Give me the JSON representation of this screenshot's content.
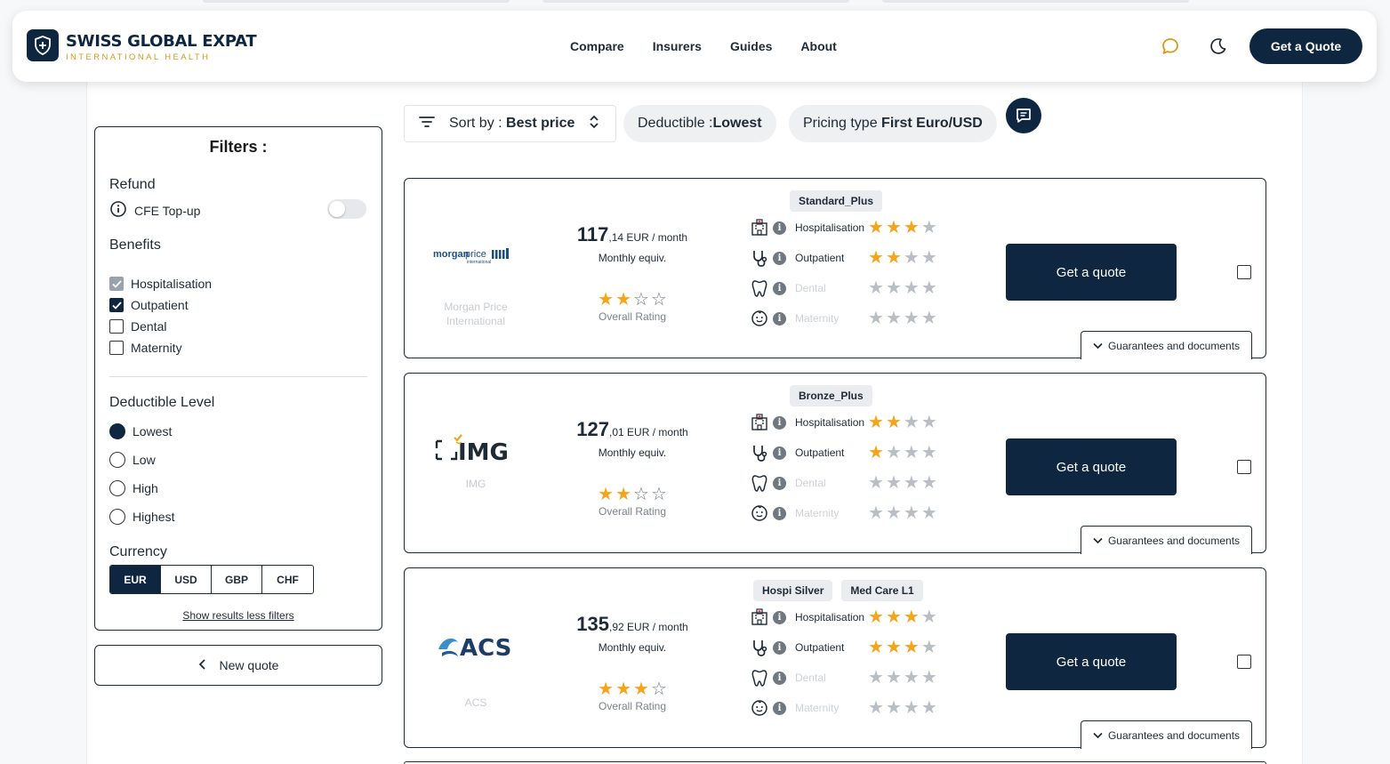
{
  "header": {
    "brand_title": "SWISS GLOBAL EXPAT",
    "brand_subtitle": "INTERNATIONAL HEALTH",
    "nav": [
      "Compare",
      "Insurers",
      "Guides",
      "About"
    ],
    "cta_label": "Get a Quote",
    "icons": [
      "chat-icon",
      "moon-icon"
    ]
  },
  "filters": {
    "title": "Filters :",
    "refund": {
      "heading": "Refund",
      "option": "CFE Top-up",
      "enabled": false
    },
    "benefits": {
      "heading": "Benefits",
      "items": [
        {
          "label": "Hospitalisation",
          "checked": true,
          "locked": true
        },
        {
          "label": "Outpatient",
          "checked": true,
          "locked": false
        },
        {
          "label": "Dental",
          "checked": false,
          "locked": false
        },
        {
          "label": "Maternity",
          "checked": false,
          "locked": false
        }
      ]
    },
    "deductible": {
      "heading": "Deductible Level",
      "options": [
        "Lowest",
        "Low",
        "High",
        "Highest"
      ],
      "selected": "Lowest"
    },
    "currency": {
      "heading": "Currency",
      "options": [
        "EUR",
        "USD",
        "GBP",
        "CHF"
      ],
      "selected": "EUR"
    },
    "show_results": "Show results less filters"
  },
  "new_quote_label": "New quote",
  "sortbar": {
    "sort_prefix": "Sort by : ",
    "sort_value": "Best price",
    "deductible_prefix": "Deductible : ",
    "deductible_value": "Lowest",
    "pricing_prefix": "Pricing type ",
    "pricing_value": "First Euro/USD"
  },
  "card_common": {
    "monthly_equiv": "Monthly equiv.",
    "overall_label": "Overall Rating",
    "cta_label": "Get a quote",
    "guarantees_label": "Guarantees and documents",
    "benefit_labels": [
      "Hospitalisation",
      "Outpatient",
      "Dental",
      "Maternity"
    ]
  },
  "plans": [
    {
      "insurer": "Morgan Price International",
      "insurer_line1": "Morgan Price",
      "insurer_line2": "International",
      "logo_text": "morganprice",
      "logo_subtext": "international",
      "tags": [
        "Standard_Plus"
      ],
      "price_int": "117",
      "price_dec": ",14",
      "price_unit": " EUR / month",
      "overall_rating": 2,
      "benefit_ratings": [
        3,
        2,
        0,
        0
      ]
    },
    {
      "insurer": "IMG",
      "insurer_line1": "IMG",
      "insurer_line2": "",
      "logo_text": "IMG",
      "logo_subtext": "",
      "tags": [
        "Bronze_Plus"
      ],
      "price_int": "127",
      "price_dec": ",01",
      "price_unit": " EUR / month",
      "overall_rating": 2,
      "benefit_ratings": [
        2,
        1,
        0,
        0
      ]
    },
    {
      "insurer": "ACS",
      "insurer_line1": "ACS",
      "insurer_line2": "",
      "logo_text": "ACS",
      "logo_subtext": "",
      "tags": [
        "Hospi Silver",
        "Med Care L1"
      ],
      "price_int": "135",
      "price_dec": ",92",
      "price_unit": " EUR / month",
      "overall_rating": 3,
      "benefit_ratings": [
        3,
        3,
        0,
        0
      ]
    }
  ],
  "colors": {
    "navy": "#0f2640",
    "gold": "#d69a1a",
    "star": "#f6a41b"
  }
}
